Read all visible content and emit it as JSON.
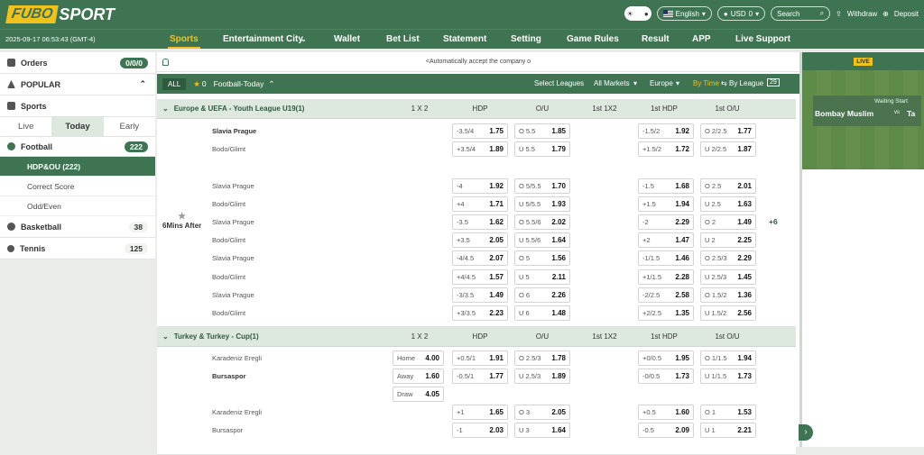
{
  "header": {
    "logo_a": "FUBO",
    "logo_b": "SPORT",
    "language": "English",
    "currency": "USD",
    "balance": "0",
    "search_placeholder": "Search",
    "withdraw": "Withdraw",
    "deposit": "Deposit"
  },
  "nav": {
    "datetime": "2025-09-17 06:53:43 (GMT-4)",
    "items": [
      "Sports",
      "Entertainment City",
      "Wallet",
      "Bet List",
      "Statement",
      "Setting",
      "Game Rules",
      "Result",
      "APP",
      "Live Support"
    ]
  },
  "sidebar": {
    "orders": "Orders",
    "orders_count": "0/0/0",
    "popular": "POPULAR",
    "sports": "Sports",
    "tabs": [
      "Live",
      "Today",
      "Early"
    ],
    "football": "Football",
    "football_count": "222",
    "subs": [
      "HDP&OU (222)",
      "Correct Score",
      "Odd/Even"
    ],
    "basketball": "Basketball",
    "basketball_count": "38",
    "tennis": "Tennis",
    "tennis_count": "125"
  },
  "marquee": "<Automatically accept the company o",
  "filter": {
    "all": "ALL",
    "fav_count": "0",
    "title": "Football-Today",
    "select_leagues": "Select Leagues",
    "all_markets": "All Markets",
    "region": "Europe",
    "by_time": "By Time",
    "by_league": "By League",
    "day": "29"
  },
  "columns": [
    "1 X 2",
    "HDP",
    "O/U",
    "1st 1X2",
    "1st HDP",
    "1st O/U"
  ],
  "league1": {
    "name": "Europe & UEFA - Youth League U19(1)",
    "time": "6Mins After",
    "more": "+6",
    "rows": [
      {
        "team": "Slavia Prague",
        "hdp": "-3.5/4",
        "hdpv": "1.75",
        "ou": "O 5.5",
        "ouv": "1.85",
        "fhdp": "-1.5/2",
        "fhdpv": "1.92",
        "fou": "O 2/2.5",
        "fouv": "1.77"
      },
      {
        "team": "Bodo/Glimt",
        "hdp": "+3.5/4",
        "hdpv": "1.89",
        "ou": "U 5.5",
        "ouv": "1.79",
        "fhdp": "+1.5/2",
        "fhdpv": "1.72",
        "fou": "U 2/2.5",
        "fouv": "1.87"
      },
      {
        "team": "Slavia Prague",
        "hdp": "-4",
        "hdpv": "1.92",
        "ou": "O 5/5.5",
        "ouv": "1.70",
        "fhdp": "-1.5",
        "fhdpv": "1.68",
        "fou": "O 2.5",
        "fouv": "2.01"
      },
      {
        "team": "Bodo/Glimt",
        "hdp": "+4",
        "hdpv": "1.71",
        "ou": "U 5/5.5",
        "ouv": "1.93",
        "fhdp": "+1.5",
        "fhdpv": "1.94",
        "fou": "U 2.5",
        "fouv": "1.63"
      },
      {
        "team": "Slavia Prague",
        "hdp": "-3.5",
        "hdpv": "1.62",
        "ou": "O 5.5/6",
        "ouv": "2.02",
        "fhdp": "-2",
        "fhdpv": "2.29",
        "fou": "O 2",
        "fouv": "1.49"
      },
      {
        "team": "Bodo/Glimt",
        "hdp": "+3.5",
        "hdpv": "2.05",
        "ou": "U 5.5/6",
        "ouv": "1.64",
        "fhdp": "+2",
        "fhdpv": "1.47",
        "fou": "U 2",
        "fouv": "2.25"
      },
      {
        "team": "Slavia Prague",
        "hdp": "-4/4.5",
        "hdpv": "2.07",
        "ou": "O 5",
        "ouv": "1.56",
        "fhdp": "-1/1.5",
        "fhdpv": "1.46",
        "fou": "O 2.5/3",
        "fouv": "2.29"
      },
      {
        "team": "Bodo/Glimt",
        "hdp": "+4/4.5",
        "hdpv": "1.57",
        "ou": "U 5",
        "ouv": "2.11",
        "fhdp": "+1/1.5",
        "fhdpv": "2.28",
        "fou": "U 2.5/3",
        "fouv": "1.45"
      },
      {
        "team": "Slavia Prague",
        "hdp": "-3/3.5",
        "hdpv": "1.49",
        "ou": "O 6",
        "ouv": "2.26",
        "fhdp": "-2/2.5",
        "fhdpv": "2.58",
        "fou": "O 1.5/2",
        "fouv": "1.36"
      },
      {
        "team": "Bodo/Glimt",
        "hdp": "+3/3.5",
        "hdpv": "2.23",
        "ou": "U 6",
        "ouv": "1.48",
        "fhdp": "+2/2.5",
        "fhdpv": "1.35",
        "fou": "U 1.5/2",
        "fouv": "2.56"
      }
    ]
  },
  "league2": {
    "name": "Turkey & Turkey - Cup(1)",
    "x12": [
      {
        "l": "Home",
        "v": "4.00"
      },
      {
        "l": "Away",
        "v": "1.60"
      },
      {
        "l": "Draw",
        "v": "4.05"
      }
    ],
    "rows": [
      {
        "team": "Karadeniz Eregli",
        "hdp": "+0.5/1",
        "hdpv": "1.91",
        "ou": "O 2.5/3",
        "ouv": "1.78",
        "fhdp": "+0/0.5",
        "fhdpv": "1.95",
        "fou": "O 1/1.5",
        "fouv": "1.94"
      },
      {
        "team": "Bursaspor",
        "hdp": "-0.5/1",
        "hdpv": "1.77",
        "ou": "U 2.5/3",
        "ouv": "1.89",
        "fhdp": "-0/0.5",
        "fhdpv": "1.73",
        "fou": "U 1/1.5",
        "fouv": "1.73"
      },
      {
        "team": "Karadeniz Eregli",
        "hdp": "+1",
        "hdpv": "1.65",
        "ou": "O 3",
        "ouv": "2.05",
        "fhdp": "+0.5",
        "fhdpv": "1.60",
        "fou": "O 1",
        "fouv": "1.53"
      },
      {
        "team": "Bursaspor",
        "hdp": "-1",
        "hdpv": "2.03",
        "ou": "U 3",
        "ouv": "1.64",
        "fhdp": "-0.5",
        "fhdpv": "2.09",
        "fou": "U 1",
        "fouv": "2.21"
      }
    ]
  },
  "right_panel": {
    "badge": "LIVE",
    "status": "Waiting Start",
    "team1": "Bombay Muslim",
    "vs": "vs",
    "team2": "Ta"
  }
}
